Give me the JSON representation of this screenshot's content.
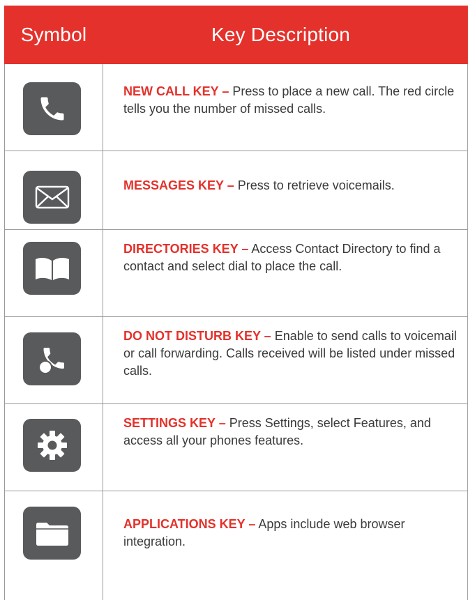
{
  "header": {
    "symbol_label": "Symbol",
    "description_label": "Key Description"
  },
  "colors": {
    "accent": "#e4312b",
    "icon_bg": "#595a5c",
    "text": "#3a3a3a",
    "rule": "#999999"
  },
  "rows": [
    {
      "icon": "phone-handset-icon",
      "key_name": "NEW CALL KEY –",
      "text": " Press to place a new call. The red circle tells you the number of missed calls."
    },
    {
      "icon": "envelope-icon",
      "key_name": "MESSAGES KEY –",
      "text": " Press to retrieve voicemails."
    },
    {
      "icon": "open-book-icon",
      "key_name": "DIRECTORIES KEY –",
      "text": " Access Contact Directory to find a contact and select dial to place the call."
    },
    {
      "icon": "do-not-disturb-phone-icon",
      "key_name": "DO NOT DISTURB KEY –",
      "text": " Enable to send calls to voicemail or call forwarding. Calls received will be listed under missed calls."
    },
    {
      "icon": "gear-icon",
      "key_name": "SETTINGS KEY –",
      "text": " Press Settings, select Features, and access all your phones features."
    },
    {
      "icon": "folder-icon",
      "key_name": "APPLICATIONS KEY –",
      "text": " Apps include web browser integration."
    }
  ]
}
